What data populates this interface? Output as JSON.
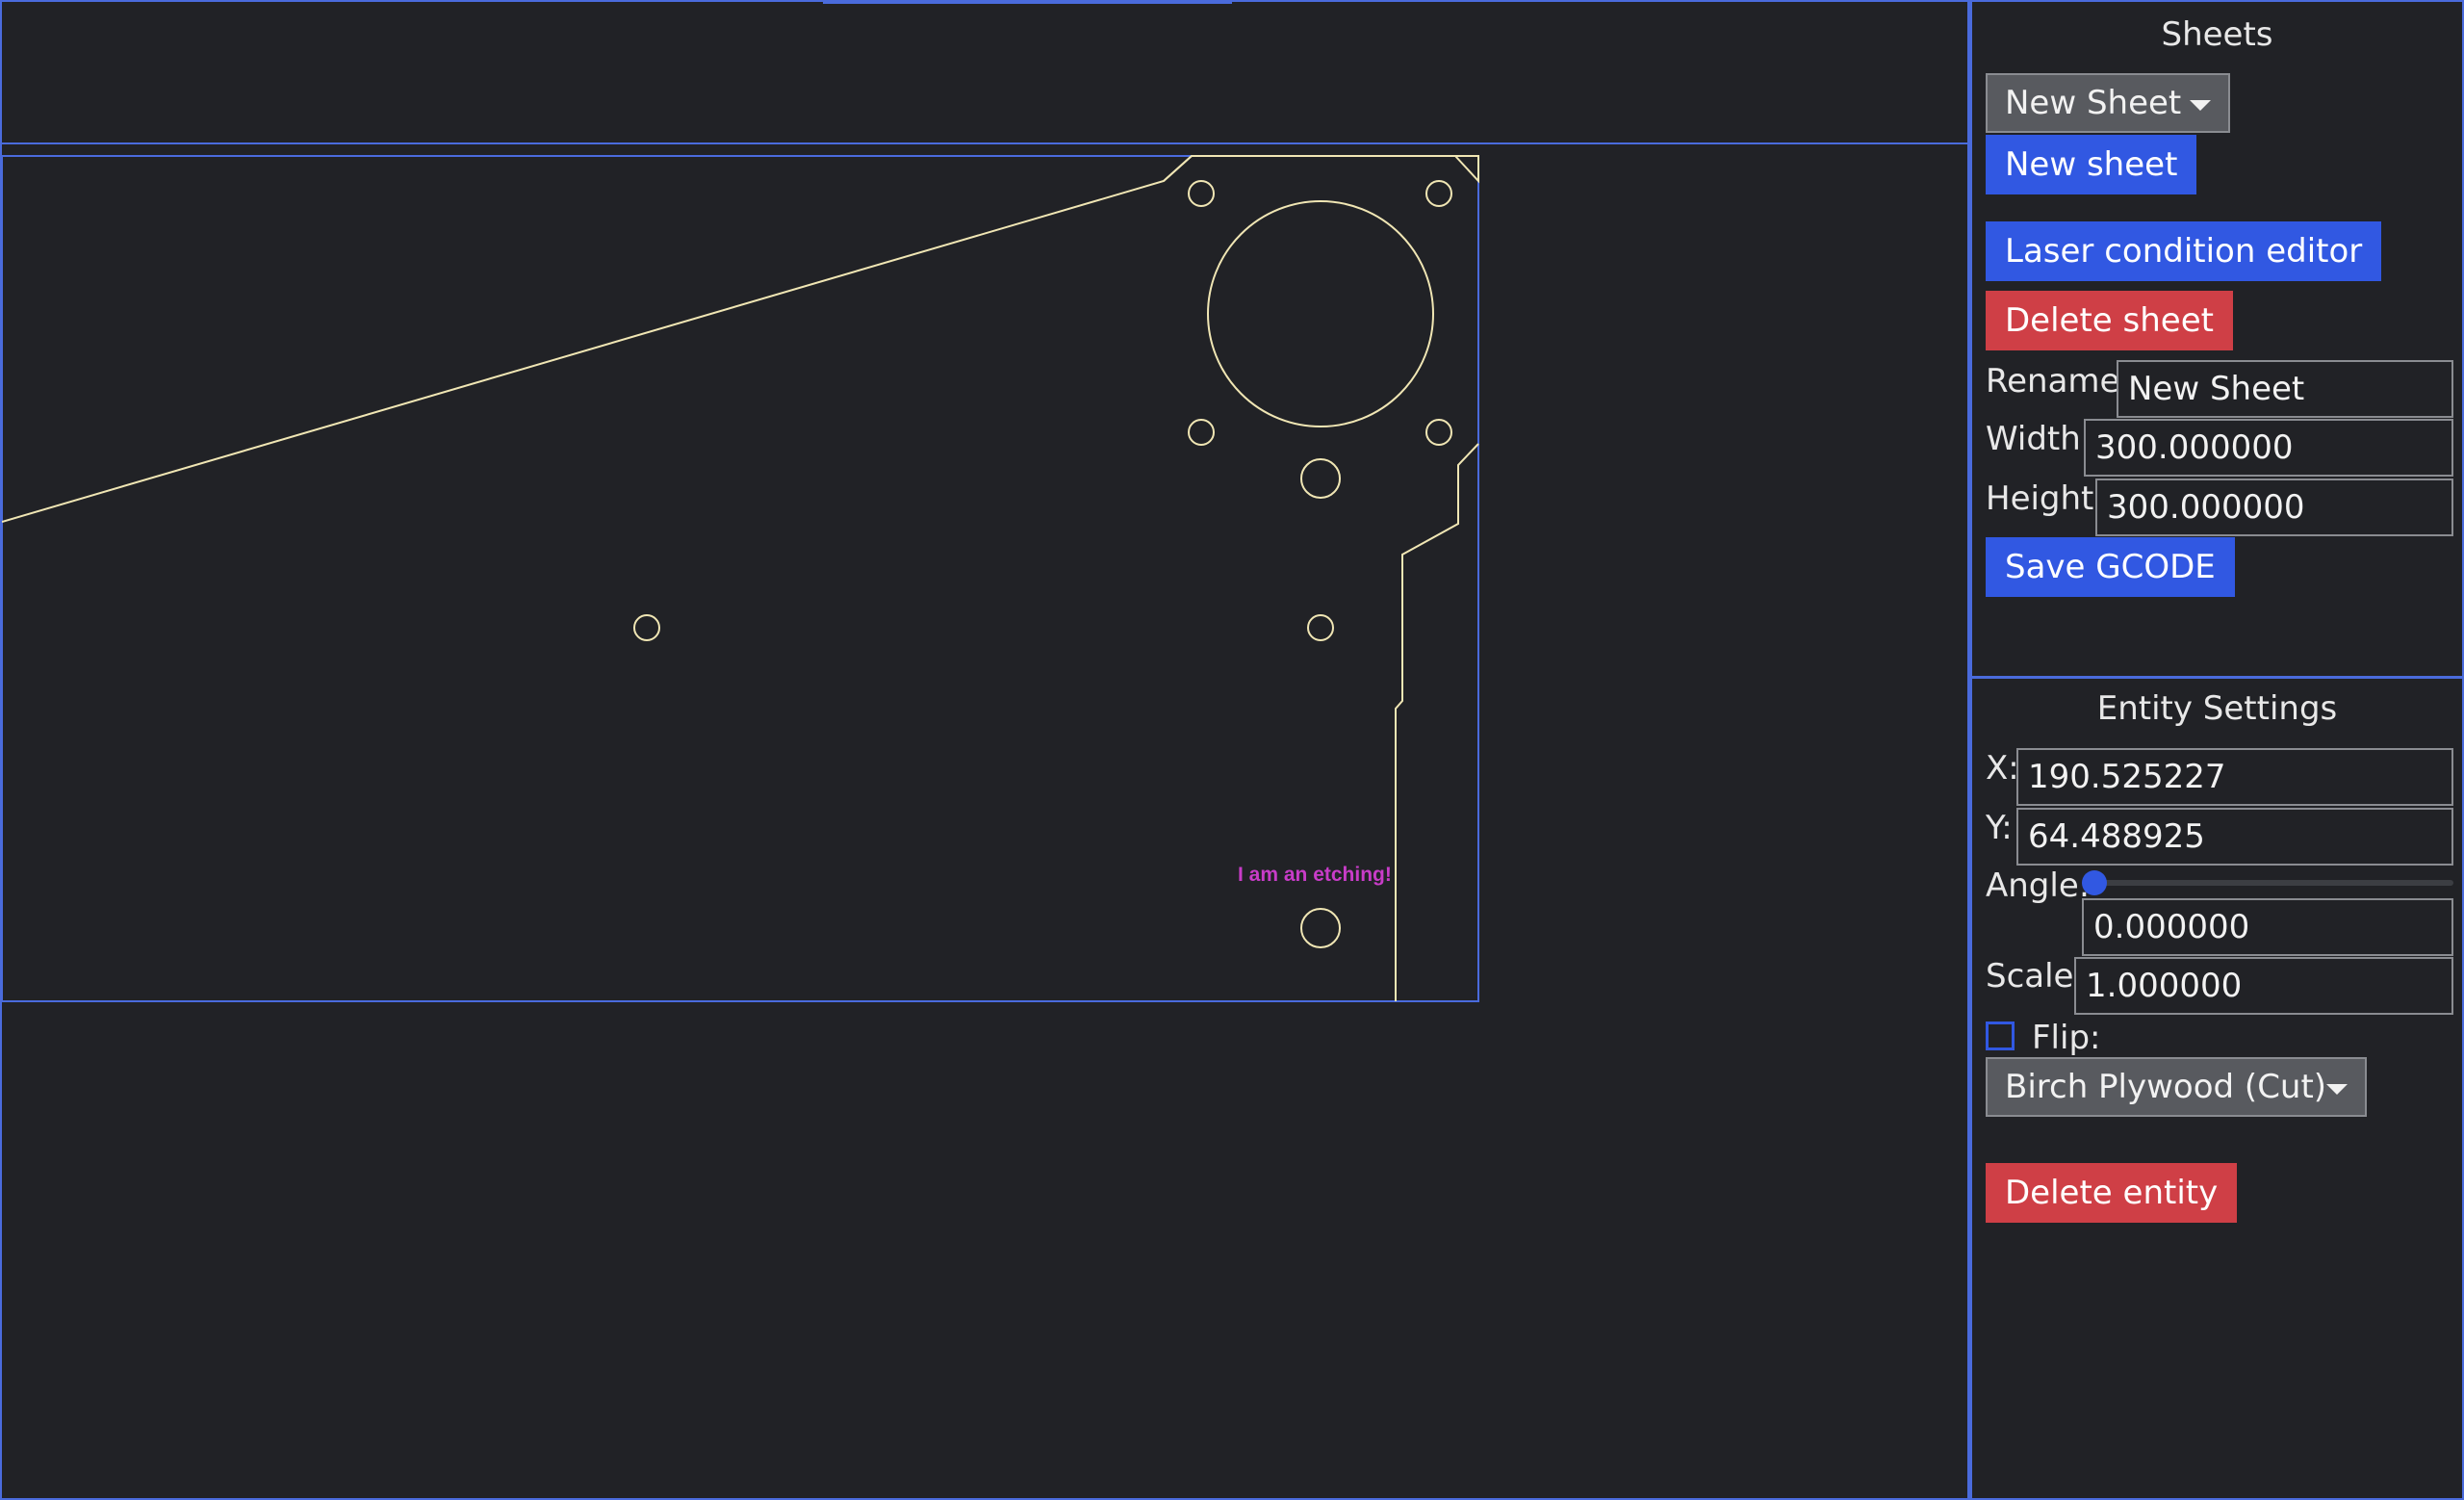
{
  "sheets_panel": {
    "title": "Sheets",
    "sheet_select": "New Sheet",
    "new_sheet_label": "New sheet",
    "laser_editor_label": "Laser condition editor",
    "delete_sheet_label": "Delete sheet",
    "rename_label": "Rename:",
    "rename_value": "New Sheet",
    "width_label": "Width:",
    "width_value": "300.000000",
    "height_label": "Height:",
    "height_value": "300.000000",
    "save_gcode_label": "Save GCODE"
  },
  "entity_panel": {
    "title": "Entity Settings",
    "x_label": "X:",
    "x_value": "190.525227",
    "y_label": "Y:",
    "y_value": "64.488925",
    "angle_label": "Angle:",
    "angle_value": "0.000000",
    "angle_slider_fraction": 0,
    "scale_label": "Scale:",
    "scale_value": "1.000000",
    "flip_label": "Flip:",
    "flip_checked": false,
    "material_select": "Birch Plywood (Cut)",
    "delete_entity_label": "Delete entity"
  },
  "canvas": {
    "etching_text": "I am an etching!"
  },
  "colors": {
    "accent": "#4a6bdc",
    "button_blue": "#3158e2",
    "button_red": "#cf3f46",
    "cut_line": "#f0e6b4",
    "etching": "#c83cc8",
    "background": "#212226"
  }
}
